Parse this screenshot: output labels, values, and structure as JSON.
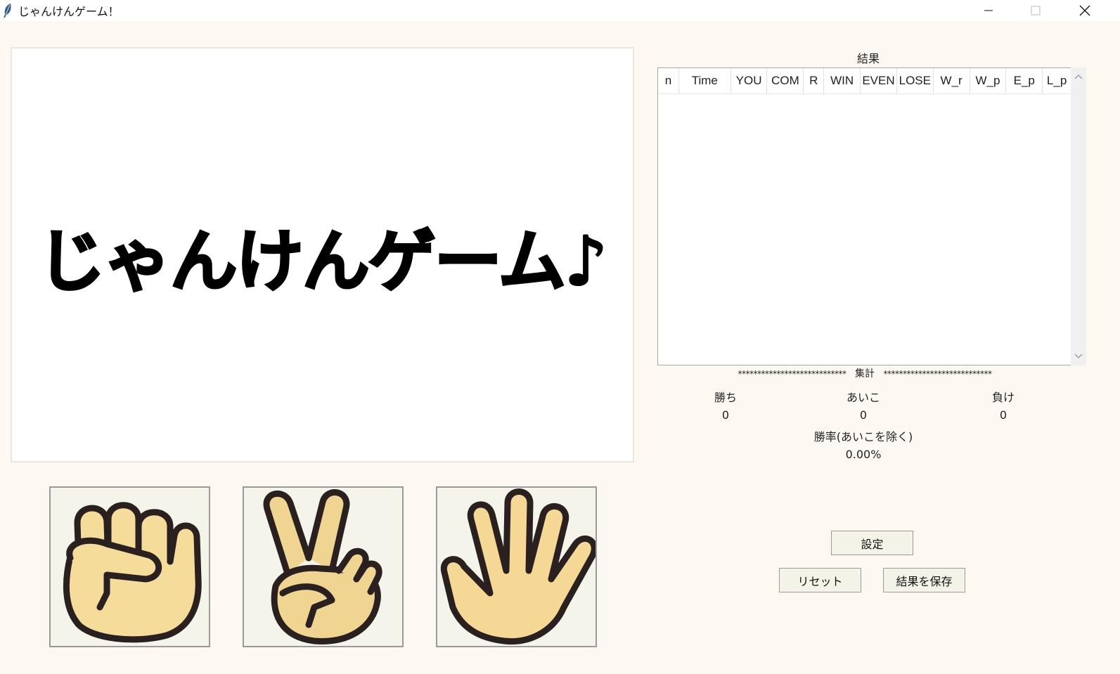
{
  "window": {
    "title": "じゃんけんゲーム！",
    "minimize_icon": "minimize-icon",
    "maximize_icon": "maximize-icon",
    "close_icon": "close-icon"
  },
  "display": {
    "banner_text": "じゃんけんゲーム♪"
  },
  "hands": [
    {
      "name": "rock",
      "icon": "fist-hand-icon"
    },
    {
      "name": "scissors",
      "icon": "peace-hand-icon"
    },
    {
      "name": "paper",
      "icon": "open-hand-icon"
    }
  ],
  "results": {
    "label": "結果",
    "columns": [
      "n",
      "Time",
      "YOU",
      "COM",
      "R",
      "WIN",
      "EVEN",
      "LOSE",
      "W_r",
      "W_p",
      "E_p",
      "L_p"
    ],
    "rows": []
  },
  "summary": {
    "heading": "集計",
    "stars": "****************************",
    "win_label": "勝ち",
    "even_label": "あいこ",
    "lose_label": "負け",
    "win_value": "0",
    "even_value": "0",
    "lose_value": "0",
    "rate_label": "勝率(あいこを除く)",
    "rate_value": "0.00%"
  },
  "buttons": {
    "settings": "設定",
    "reset": "リセット",
    "save": "結果を保存"
  },
  "colors": {
    "background": "#fdf9f2",
    "hand_fill": "#f5dc9a",
    "hand_stroke": "#2a2020"
  }
}
